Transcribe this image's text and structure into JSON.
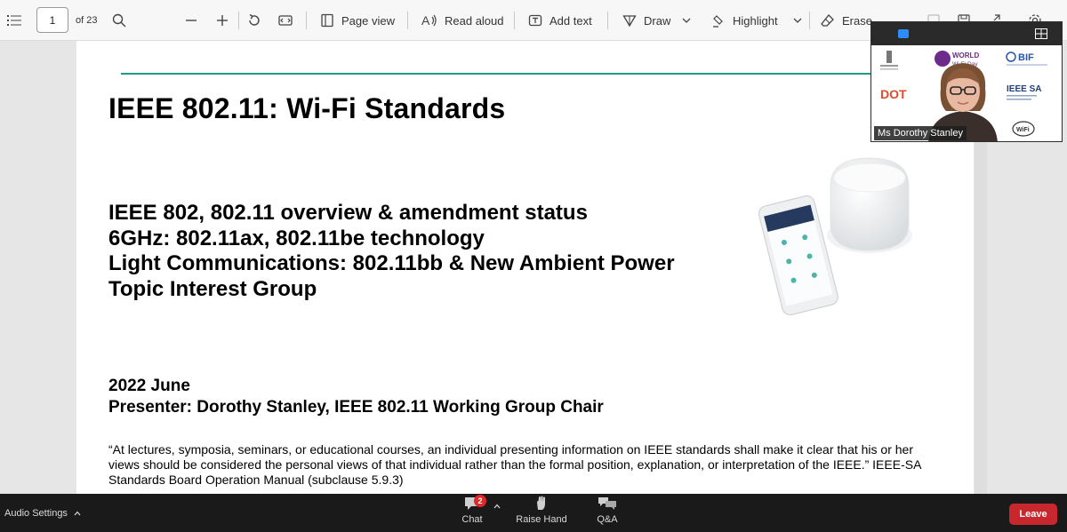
{
  "toolbar": {
    "page_current": "1",
    "page_total": "of 23",
    "page_view": "Page view",
    "read_aloud": "Read aloud",
    "add_text": "Add text",
    "draw": "Draw",
    "highlight": "Highlight",
    "erase": "Erase"
  },
  "slide": {
    "title": "IEEE 802.11: Wi-Fi Standards",
    "topics": [
      "IEEE 802, 802.11 overview & amendment status",
      "6GHz: 802.11ax, 802.11be technology",
      "Light Communications: 802.11bb & New Ambient Power",
      "Topic Interest Group"
    ],
    "date": "2022 June",
    "presenter": "Presenter: Dorothy Stanley, IEEE 802.11 Working Group Chair",
    "disclaimer": "“At lectures, symposia, seminars, or educational courses, an individual presenting information on IEEE standards shall make it clear that his or her views should be considered the personal views of that individual rather than the formal position, explanation, or interpretation of the IEEE.” IEEE-SA Standards Board Operation Manual (subclause 5.9.3)"
  },
  "video": {
    "speaker": "Ms Dorothy Stanley",
    "logos": [
      "WORLD",
      "Wi-Fi Day",
      "BIF",
      "IEEE SA",
      "DOT",
      "WiFi"
    ]
  },
  "meeting_bar": {
    "audio_settings": "Audio Settings",
    "chat": "Chat",
    "chat_badge": "2",
    "raise_hand": "Raise Hand",
    "qa": "Q&A",
    "leave": "Leave"
  },
  "colors": {
    "accent_rule": "#1e9a8a",
    "leave": "#c8282d",
    "badge": "#e02828"
  }
}
